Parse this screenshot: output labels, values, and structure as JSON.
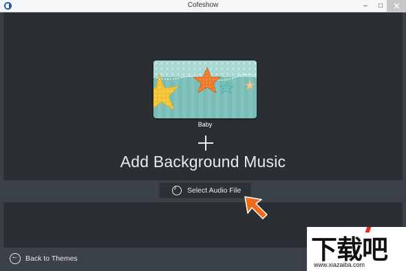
{
  "window": {
    "title": "Cofeshow",
    "minimize_glyph": "–",
    "maximize_glyph": "□"
  },
  "theme": {
    "name": "Baby"
  },
  "heading": "Add Background Music",
  "select_audio": {
    "label": "Select Audio File",
    "icon": "music-note-icon"
  },
  "back": {
    "label": "Back to Themes",
    "icon": "back-arrow-icon"
  },
  "colors": {
    "background": "#2b2f33",
    "strip": "#3b4148",
    "accent_arrow": "#f26a1b",
    "card_teal": "#8ec9c4"
  },
  "watermark": {
    "text": "下载吧",
    "url": "www.xiazaiba.com"
  }
}
